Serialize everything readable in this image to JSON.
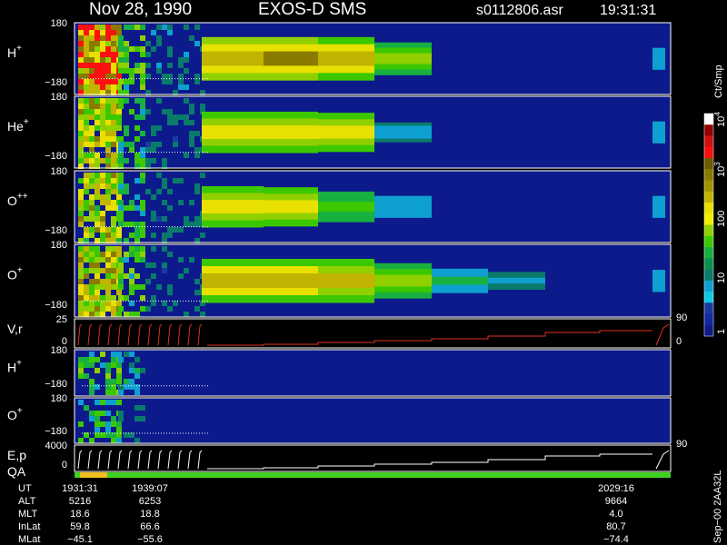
{
  "header": {
    "date": "Nov 28, 1990",
    "instrument": "EXOS-D SMS",
    "file_name": "s0112806.asr",
    "time": "19:31:31"
  },
  "chart_data": {
    "type": "heatmap",
    "panels": [
      {
        "id": "h-plus",
        "label": "H",
        "sup": "+",
        "y_ticks": [
          "180",
          "−180"
        ],
        "intensity": [
          1.0,
          0.5,
          0.15,
          0.9,
          0.95,
          0.85,
          0.55,
          0.0,
          0.0,
          0.0,
          0.3,
          0.0
        ]
      },
      {
        "id": "he-plus",
        "label": "He",
        "sup": "+",
        "y_ticks": [
          "180",
          "−180"
        ],
        "intensity": [
          0.7,
          0.4,
          0.1,
          0.75,
          0.75,
          0.7,
          0.25,
          0.0,
          0.0,
          0.0,
          0.3,
          0.0
        ]
      },
      {
        "id": "o-plusplus",
        "label": "O",
        "sup": "++",
        "y_ticks": [
          "180",
          "−180"
        ],
        "intensity": [
          0.7,
          0.4,
          0.1,
          0.75,
          0.7,
          0.5,
          0.3,
          0.0,
          0.0,
          0.0,
          0.3,
          0.0
        ]
      },
      {
        "id": "o-plus",
        "label": "O",
        "sup": "+",
        "y_ticks": [
          "180",
          "−180"
        ],
        "intensity": [
          0.75,
          0.45,
          0.1,
          0.85,
          0.85,
          0.8,
          0.6,
          0.35,
          0.2,
          0.0,
          0.3,
          0.0
        ]
      },
      {
        "id": "h-plus-2",
        "label": "H",
        "sup": "+",
        "y_ticks": [
          "180",
          "−180"
        ],
        "intensity": [
          0.45,
          0.25,
          0.0,
          0.0,
          0.0,
          0.0,
          0.0,
          0.0,
          0.0,
          0.0,
          0.0,
          0.0
        ]
      },
      {
        "id": "o-plus-2",
        "label": "O",
        "sup": "+",
        "y_ticks": [
          "180",
          "−180"
        ],
        "intensity": [
          0.4,
          0.1,
          0.0,
          0.0,
          0.0,
          0.0,
          0.0,
          0.0,
          0.0,
          0.0,
          0.0,
          0.0
        ]
      }
    ],
    "line_panels": [
      {
        "id": "v-r",
        "label": "V,r",
        "y_ticks": [
          "25",
          "0"
        ],
        "right_ticks": [
          "90",
          "0"
        ],
        "color": "#e03020"
      },
      {
        "id": "e-p",
        "label": "E,p",
        "y_ticks": [
          "4000",
          "0"
        ],
        "right_ticks": [
          "90"
        ],
        "color": "#ffffff"
      }
    ],
    "qa_label": "QA",
    "colorbar": {
      "label": "Ct/Smp",
      "ticks": [
        "10",
        "10",
        "100",
        "10",
        "1"
      ],
      "tick_exponents": [
        "4",
        "3",
        "",
        "",
        ""
      ],
      "colors": [
        "#ffffff",
        "#900000",
        "#d01010",
        "#ff1010",
        "#6a5a00",
        "#8a7a00",
        "#a09400",
        "#c0b400",
        "#e8e000",
        "#f0f000",
        "#90d000",
        "#3cc800",
        "#18b040",
        "#0c9050",
        "#0a7a6a",
        "#0ea0d0",
        "#10c8e0",
        "#1a3aa0",
        "#1428a0",
        "#101a8a"
      ]
    },
    "time_table": {
      "row_labels": [
        "UT",
        "ALT",
        "MLT",
        "InLat",
        "MLat"
      ],
      "columns": [
        {
          "values": [
            "1931:31",
            "5216",
            "18.6",
            "59.8",
            "−45.1"
          ]
        },
        {
          "values": [
            "1939:07",
            "6253",
            "18.8",
            "66.6",
            "−55.6"
          ]
        },
        {
          "values": [
            "2029:16",
            "9664",
            "4.0",
            "80.7",
            "−74.4"
          ]
        }
      ]
    },
    "footer_note": "Sep−00 2AA32L"
  }
}
